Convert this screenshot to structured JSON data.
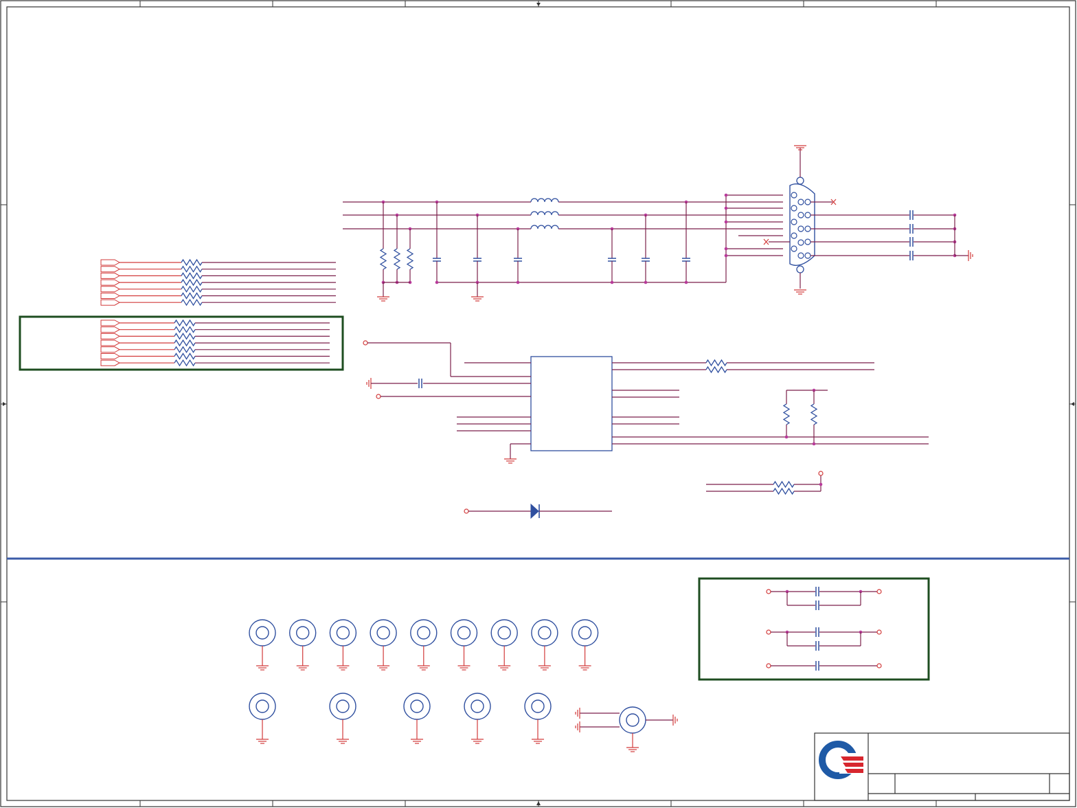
{
  "colors": {
    "border": "#333333",
    "wire": "#7a1f4a",
    "pin": "#d23a3a",
    "component": "#2f4f9f",
    "junction": "#b83a9a",
    "frame_green": "#1e4d20",
    "divider": "#3b5ba8",
    "logo_blue": "#1f5aa6",
    "logo_red": "#d7262e"
  },
  "icons": {
    "ground": "ground-icon",
    "resistor": "resistor-icon",
    "capacitor": "capacitor-icon",
    "inductor": "inductor-icon",
    "diode": "diode-icon",
    "connector": "db15-connector-icon",
    "mounting_hole": "mounting-hole-icon",
    "logo": "company-logo-icon"
  },
  "counts": {
    "mounting_holes_top_row": 9,
    "mounting_holes_bottom_row": 5,
    "resistor_array_rows": 7
  }
}
